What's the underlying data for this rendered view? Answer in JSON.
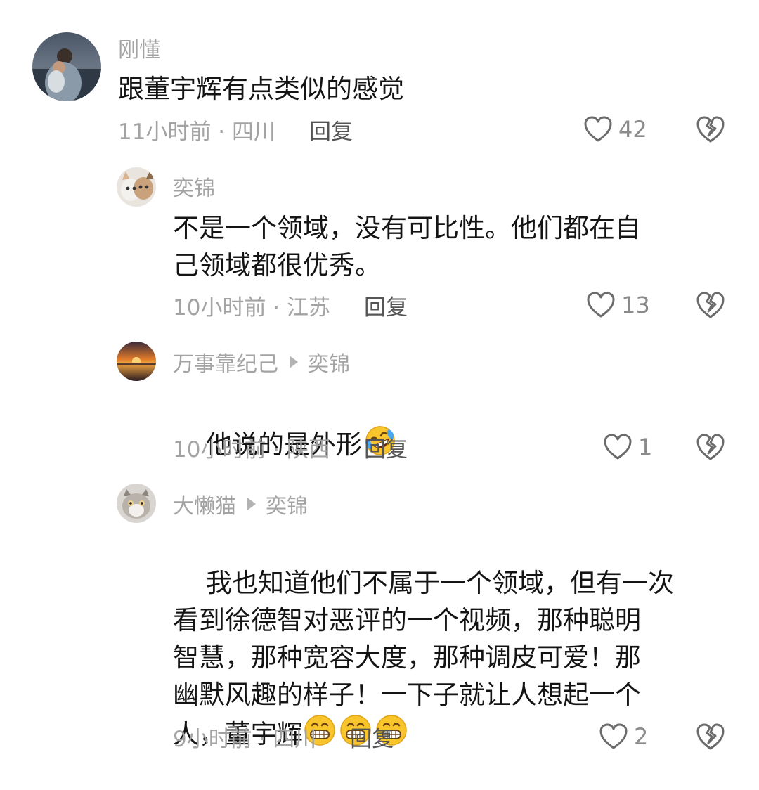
{
  "comments": [
    {
      "author": "刚懂",
      "text": "跟董宇辉有点类似的感觉",
      "time_location": "11小时前 · 四川",
      "reply_label": "回复",
      "likes": "42",
      "avatar_icon": "man-holding-child-photo"
    },
    {
      "author": "奕锦",
      "text": "不是一个领域，没有可比性。他们都在自\n己领域都很优秀。",
      "time_location": "10小时前 · 江苏",
      "reply_label": "回复",
      "likes": "13",
      "avatar_icon": "cat-photo"
    },
    {
      "author": "万事靠纪己",
      "reply_to": "奕锦",
      "text": "他说的是外形",
      "emoji": "rofl-emoji",
      "time_location": "10小时前 · 陕西",
      "reply_label": "回复",
      "likes": "1",
      "avatar_icon": "sunset-photo"
    },
    {
      "author": "大懒猫",
      "reply_to": "奕锦",
      "text": "我也知道他们不属于一个领域，但有一次\n看到徐德智对恶评的一个视频，那种聪明\n智慧，那种宽容大度，那种调皮可爱！那\n幽默风趣的样子！一下子就让人想起一个\n人，董宇辉",
      "emoji": "grinning-emoji",
      "time_location": "9小时前 · 四川",
      "reply_label": "回复",
      "likes": "2",
      "avatar_icon": "cat-photo"
    }
  ],
  "icons": {
    "like": "heart-outline-icon",
    "dislike": "broken-heart-icon"
  },
  "colors": {
    "meta_text": "#a3a3a3",
    "body_text": "#141414",
    "icon_stroke": "#6b6b6b"
  }
}
